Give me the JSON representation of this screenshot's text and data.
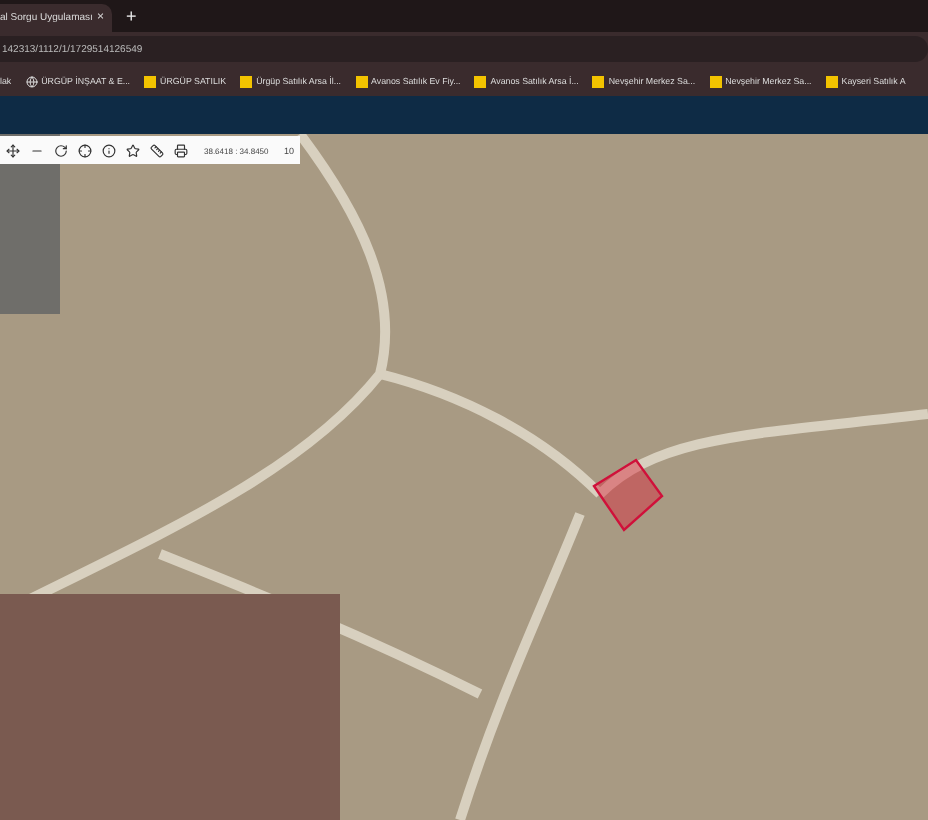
{
  "tabs": [
    {
      "title": "al Sorgu Uygulaması",
      "close": "×",
      "selected": true
    }
  ],
  "new_tab": "+",
  "address": "142313/1112/1/1729514126549",
  "bookmarks": [
    {
      "label": "lak",
      "kind": "plain"
    },
    {
      "label": "ÜRGÜP İNŞAAT & E...",
      "kind": "globe"
    },
    {
      "label": "ÜRGÜP SATILIK",
      "kind": "s"
    },
    {
      "label": "Ürgüp Satılık Arsa İl...",
      "kind": "s"
    },
    {
      "label": "Avanos Satılık Ev Fiy...",
      "kind": "s"
    },
    {
      "label": "Avanos Satılık Arsa İ...",
      "kind": "s"
    },
    {
      "label": "Nevşehir Merkez Sa...",
      "kind": "s"
    },
    {
      "label": "Nevşehir Merkez Sa...",
      "kind": "s"
    },
    {
      "label": "Kayseri Satılık A",
      "kind": "s"
    }
  ],
  "map_toolbar": {
    "coordinates": "38.6418 : 34.8450",
    "zoom": "10"
  }
}
